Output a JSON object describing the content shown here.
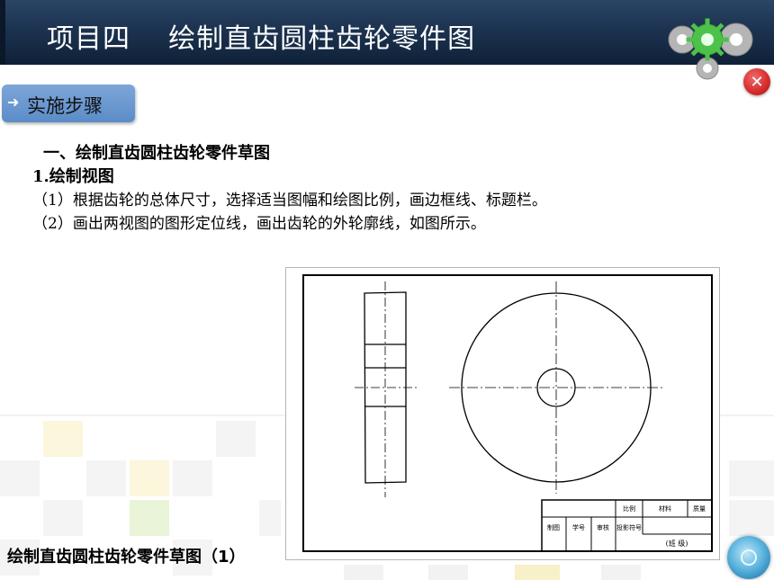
{
  "header": {
    "title": "项目四    绘制直齿圆柱齿轮零件图",
    "gear_colors": {
      "main": "#4cc24a",
      "side": "#a8a8a8"
    }
  },
  "controls": {
    "close_icon": "close-icon"
  },
  "step_tab": {
    "label": "实施步骤",
    "arrow_icon": "arrow-right-icon"
  },
  "content": {
    "heading": "一、绘制直齿圆柱齿轮零件草图",
    "subheading": "1.绘制视图",
    "steps": [
      "（1）根据齿轮的总体尺寸，选择适当图幅和绘图比例，画边框线、标题栏。",
      "（2）画出两视图的图形定位线，画出齿轮的外轮廓线，如图所示。"
    ]
  },
  "title_block": {
    "row1": [
      "比例",
      "材料",
      "质量"
    ],
    "row2": [
      "制图",
      "学号",
      "审核",
      "投影符号"
    ],
    "class_label": "(班  级)"
  },
  "caption": "绘制直齿圆柱齿轮零件草图（1）"
}
